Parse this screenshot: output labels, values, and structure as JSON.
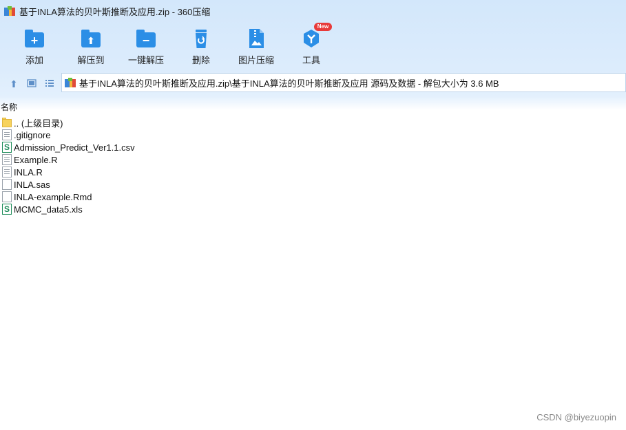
{
  "window": {
    "title": "基于INLA算法的贝叶斯推断及应用.zip - 360压缩"
  },
  "toolbar": {
    "add_label": "添加",
    "extract_label": "解压到",
    "oneclick_label": "一键解压",
    "delete_label": "删除",
    "imgcompress_label": "图片压缩",
    "tools_label": "工具",
    "tools_badge": "New"
  },
  "addressbar": {
    "path": "基于INLA算法的贝叶斯推断及应用.zip\\基于INLA算法的贝叶斯推断及应用 源码及数据 - 解包大小为 3.6 MB"
  },
  "list": {
    "column_name": "名称",
    "items": [
      {
        "name": ".. (上级目录)",
        "type": "parent-folder"
      },
      {
        "name": ".gitignore",
        "type": "text"
      },
      {
        "name": "Admission_Predict_Ver1.1.csv",
        "type": "spreadsheet"
      },
      {
        "name": "Example.R",
        "type": "text"
      },
      {
        "name": "INLA.R",
        "type": "text"
      },
      {
        "name": "INLA.sas",
        "type": "blank"
      },
      {
        "name": "INLA-example.Rmd",
        "type": "blank"
      },
      {
        "name": "MCMC_data5.xls",
        "type": "spreadsheet"
      }
    ]
  },
  "watermark": "CSDN @biyezuopin",
  "colors": {
    "accent": "#2b8ee6",
    "toolbar_bg": "#d3e7fb",
    "badge": "#e83a3a"
  }
}
